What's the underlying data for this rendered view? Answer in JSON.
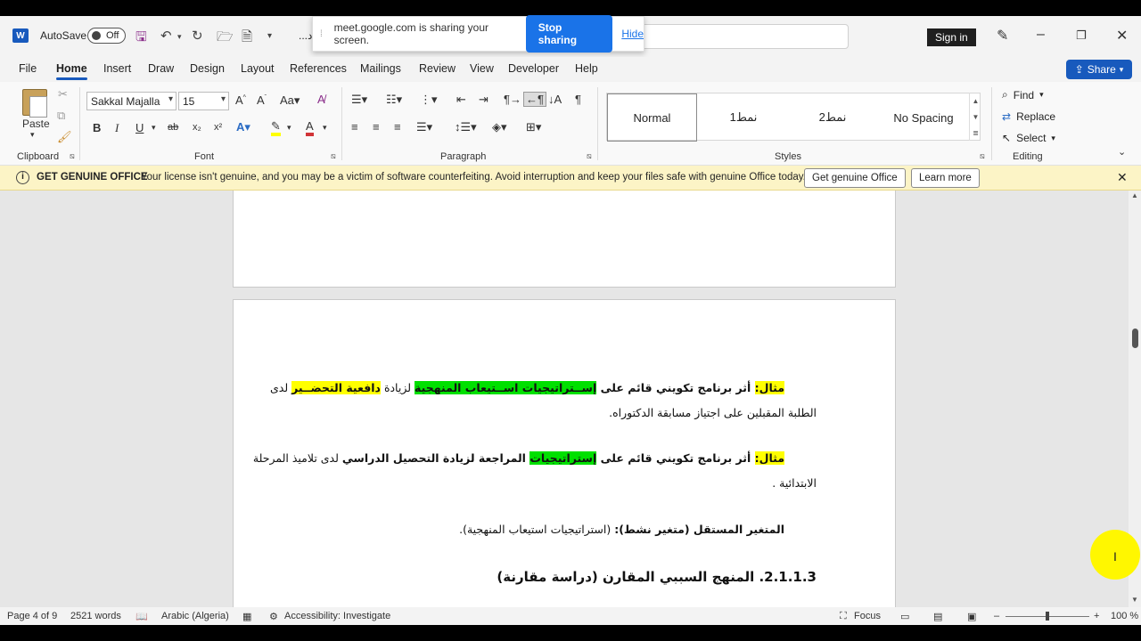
{
  "titlebar": {
    "app_badge": "W",
    "autosave_label": "AutoSave",
    "autosave_state": "Off",
    "title_truncated": "...د",
    "signin_label": "Sign in"
  },
  "share_banner": {
    "message": "meet.google.com is sharing your screen.",
    "stop_label": "Stop sharing",
    "hide_label": "Hide"
  },
  "menu": {
    "items": [
      "File",
      "Home",
      "Insert",
      "Draw",
      "Design",
      "Layout",
      "References",
      "Mailings",
      "Review",
      "View",
      "Developer",
      "Help"
    ],
    "active": "Home",
    "share_label": "Share"
  },
  "ribbon": {
    "clipboard": {
      "paste_label": "Paste",
      "group_label": "Clipboard"
    },
    "font": {
      "family": "Sakkal Majalla",
      "size": "15",
      "group_label": "Font",
      "bold": "B",
      "italic": "I",
      "underline": "U"
    },
    "paragraph": {
      "group_label": "Paragraph"
    },
    "styles": {
      "items": [
        "Normal",
        "نمط1",
        "نمط2",
        "No Spacing"
      ],
      "selected": "Normal",
      "group_label": "Styles"
    },
    "editing": {
      "find_label": "Find",
      "replace_label": "Replace",
      "select_label": "Select",
      "group_label": "Editing"
    }
  },
  "infobar": {
    "title": "GET GENUINE OFFICE",
    "message": "Your license isn't genuine, and you may be a victim of software counterfeiting. Avoid interruption and keep your files safe with genuine Office today.",
    "primary_button": "Get genuine Office",
    "secondary_button": "Learn more"
  },
  "document": {
    "ex1": {
      "label": "مثال:",
      "t1": " أثر برنامج تكويني قائم على ",
      "hl_green": "إســتراتيجيات اســتيعاب المنهجية",
      "t2": " لزيادة ",
      "hl_yellow": "دافعية التحضــير",
      "t3": " لدى",
      "line2": "الطلبة المقبلين على اجتياز مسابقة الدكتوراه."
    },
    "ex2": {
      "label": "مثال:",
      "t1": " أثر برنامج تكويني قائم على ",
      "hl_green": "إستراتيجيات",
      "t2": " المراجعة لزيادة التحصيل الدراسي",
      "t3": " لدى تلاميذ المرحلة",
      "line2": "الابتدائية ."
    },
    "indep": {
      "bold": "المتغير المستقل (متغير نشط):",
      "rest": " (استراتيجيات استيعاب المنهجية)."
    },
    "heading": "2.1.1.3. المنهج السببي المقارن (دراسة مقارنة)"
  },
  "status": {
    "page": "Page 4 of 9",
    "words": "2521 words",
    "language": "Arabic (Algeria)",
    "accessibility": "Accessibility: Investigate",
    "focus": "Focus",
    "zoom": "100 %"
  }
}
